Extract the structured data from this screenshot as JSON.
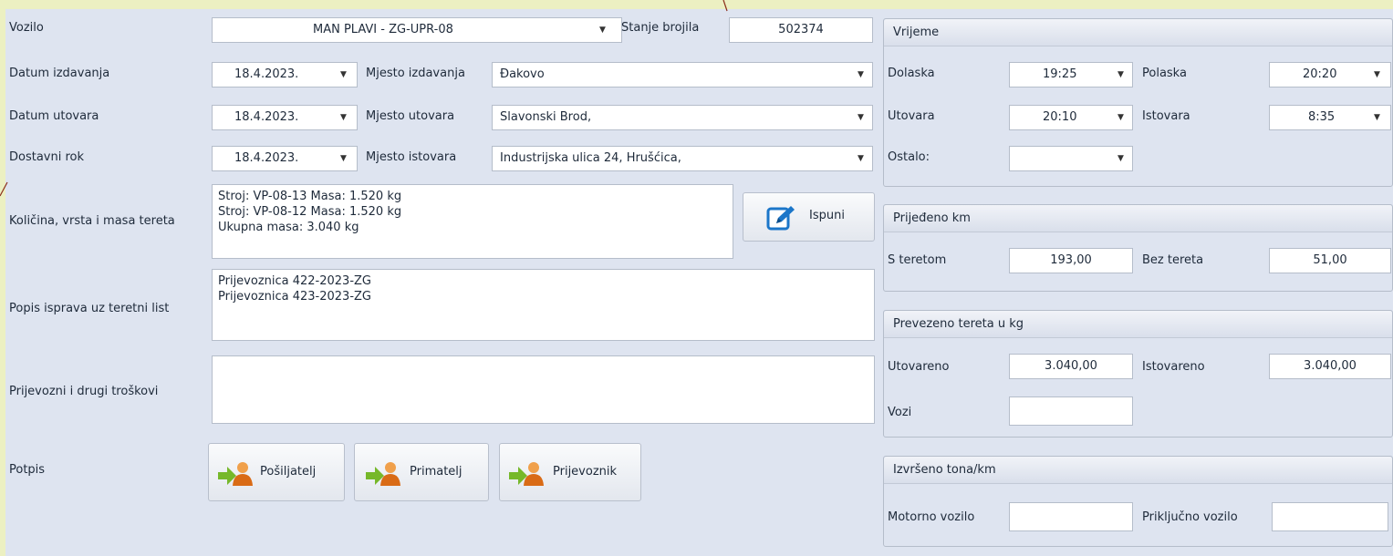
{
  "form": {
    "vozilo": {
      "label": "Vozilo",
      "value": "MAN PLAVI  - ZG-UPR-08"
    },
    "stanje_brojila": {
      "label": "Stanje brojila",
      "value": "502374"
    },
    "datum_izdavanja": {
      "label": "Datum izdavanja",
      "value": "18.4.2023."
    },
    "mjesto_izdavanja": {
      "label": "Mjesto izdavanja",
      "value": "Đakovo"
    },
    "datum_utovara": {
      "label": "Datum utovara",
      "value": "18.4.2023."
    },
    "mjesto_utovara": {
      "label": "Mjesto utovara",
      "value": "Slavonski Brod,"
    },
    "dostavni_rok": {
      "label": "Dostavni rok",
      "value": "18.4.2023."
    },
    "mjesto_istovara": {
      "label": "Mjesto istovara",
      "value": "Industrijska ulica 24, Hrušćica,"
    },
    "kolicina": {
      "label": "Količina, vrsta i masa tereta",
      "lines": [
        "Stroj: VP-08-13 Masa: 1.520 kg",
        "Stroj: VP-08-12 Masa: 1.520 kg",
        "Ukupna masa: 3.040 kg"
      ]
    },
    "ispuni_label": "Ispuni",
    "popis_isprava": {
      "label": "Popis isprava uz teretni list",
      "lines": [
        "Prijevoznica 422-2023-ZG",
        "Prijevoznica 423-2023-ZG"
      ]
    },
    "troskovi": {
      "label": "Prijevozni i drugi troškovi",
      "value": ""
    },
    "potpis": {
      "label": "Potpis",
      "buttons": [
        "Pošiljatelj",
        "Primatelj",
        "Prijevoznik"
      ]
    }
  },
  "vrijeme": {
    "title": "Vrijeme",
    "dolaska": {
      "label": "Dolaska",
      "value": "19:25"
    },
    "polaska": {
      "label": "Polaska",
      "value": "20:20"
    },
    "utovara": {
      "label": "Utovara",
      "value": "20:10"
    },
    "istovara": {
      "label": "Istovara",
      "value": "8:35"
    },
    "ostalo": {
      "label": "Ostalo:",
      "value": ""
    }
  },
  "prijedeno": {
    "title": "Prijeđeno km",
    "s_teretom": {
      "label": "S teretom",
      "value": "193,00"
    },
    "bez_tereta": {
      "label": "Bez tereta",
      "value": "51,00"
    }
  },
  "prevezeno": {
    "title": "Prevezeno tereta u kg",
    "utovareno": {
      "label": "Utovareno",
      "value": "3.040,00"
    },
    "istovareno": {
      "label": "Istovareno",
      "value": "3.040,00"
    },
    "vozi": {
      "label": "Vozi",
      "value": ""
    }
  },
  "izvrseno": {
    "title": "Izvršeno tona/km",
    "motorno": {
      "label": "Motorno vozilo",
      "value": ""
    },
    "prikljucno": {
      "label": "Priključno vozilo",
      "value": ""
    }
  },
  "icons": {
    "dropdown": "chevron-down-icon",
    "edit": "pencil-edit-icon",
    "user": "user-arrow-icon"
  }
}
